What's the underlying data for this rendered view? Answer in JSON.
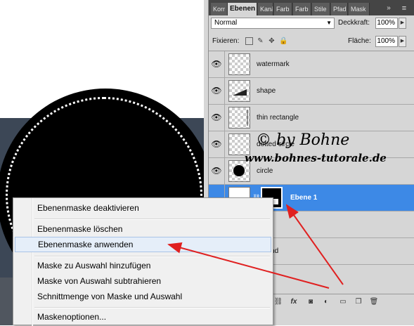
{
  "panel": {
    "tabs": [
      "Korr",
      "Ebenen",
      "Kanä",
      "Farb",
      "Farb",
      "Stile",
      "Pfad",
      "Mask"
    ],
    "active_tab": 1,
    "tab_arrows": "»",
    "tab_menu": "≡",
    "blend_mode": "Normal",
    "opacity_label": "Deckkraft:",
    "opacity_value": "100%",
    "lock_label": "Fixieren:",
    "fill_label": "Fläche:",
    "fill_value": "100%",
    "layers": [
      {
        "name": "watermark",
        "visible": true
      },
      {
        "name": "shape",
        "visible": true
      },
      {
        "name": "thin rectangle",
        "visible": true
      },
      {
        "name": "dotted circle",
        "visible": true
      },
      {
        "name": "circle",
        "visible": true
      },
      {
        "name": "Ebene 1",
        "visible": false,
        "selected": true
      },
      {
        "name": "ngle",
        "visible": false
      },
      {
        "name": "ground",
        "visible": false
      }
    ]
  },
  "context_menu": {
    "items": [
      {
        "label": "Ebenenmaske deaktivieren"
      },
      {
        "label": "Ebenenmaske löschen"
      },
      {
        "label": "Ebenenmaske anwenden",
        "highlighted": true
      },
      {
        "label": "Maske zu Auswahl hinzufügen"
      },
      {
        "label": "Maske von Auswahl subtrahieren"
      },
      {
        "label": "Schnittmenge von Maske und Auswahl"
      },
      {
        "label": "Maskenoptionen..."
      }
    ]
  },
  "watermark": {
    "line1": "© by Bohne",
    "line2": "www.bohnes-tutorale.de"
  },
  "colors": {
    "selection": "#3d89e6",
    "arrow": "#e02020",
    "menu_highlight": "#e5eef9"
  }
}
